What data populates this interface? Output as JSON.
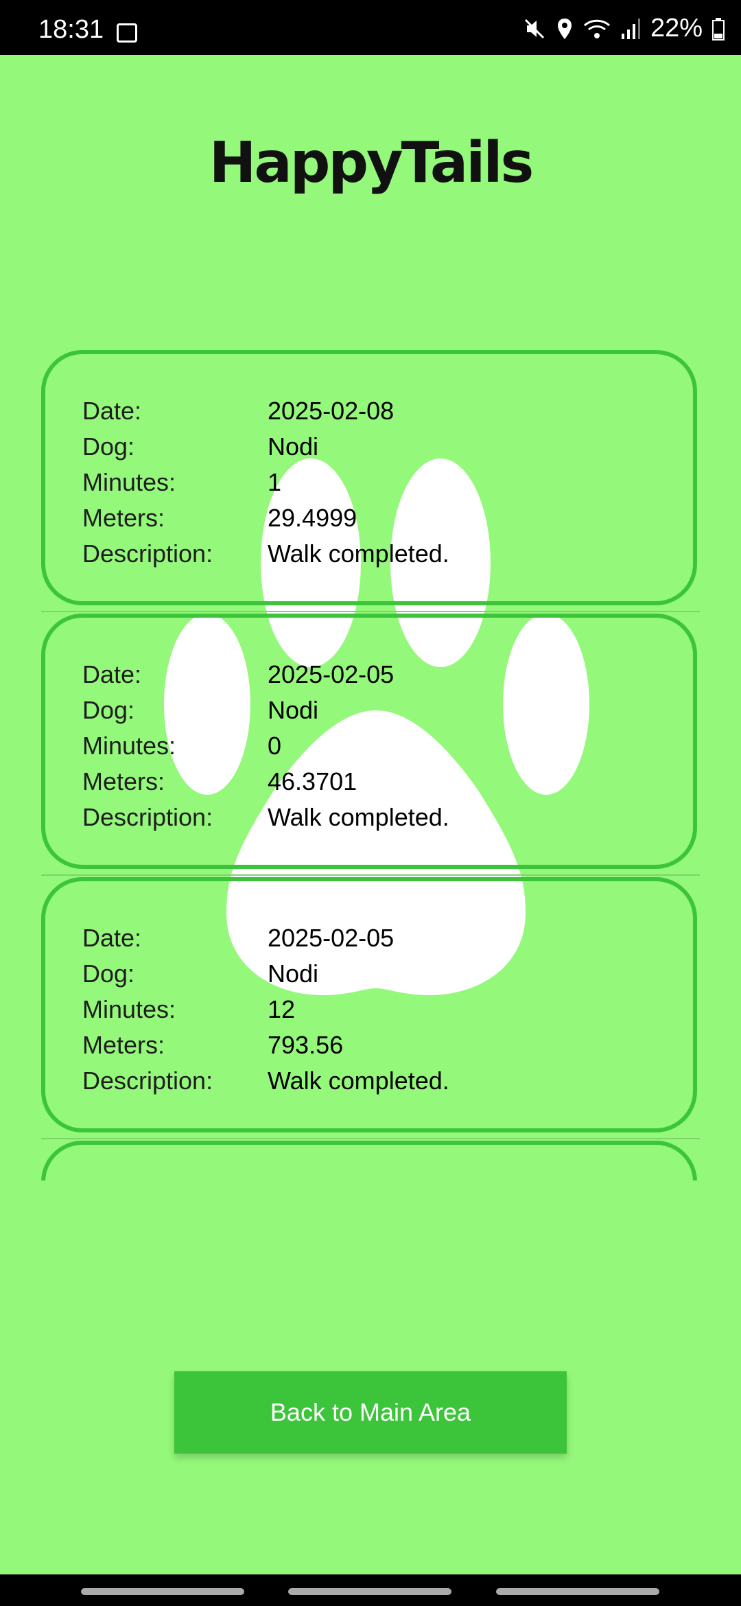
{
  "status": {
    "time": "18:31",
    "battery": "22%"
  },
  "app": {
    "title": "HappyTails"
  },
  "walks": [
    {
      "date_label": "Date:",
      "date": "2025-02-08",
      "dog_label": "Dog:",
      "dog": "Nodi",
      "minutes_label": "Minutes:",
      "minutes": "1",
      "meters_label": "Meters:",
      "meters": "29.4999",
      "description_label": "Description:",
      "description": "Walk completed."
    },
    {
      "date_label": "Date:",
      "date": "2025-02-05",
      "dog_label": "Dog:",
      "dog": "Nodi",
      "minutes_label": "Minutes:",
      "minutes": "0",
      "meters_label": "Meters:",
      "meters": "46.3701",
      "description_label": "Description:",
      "description": "Walk completed."
    },
    {
      "date_label": "Date:",
      "date": "2025-02-05",
      "dog_label": "Dog:",
      "dog": "Nodi",
      "minutes_label": "Minutes:",
      "minutes": "12",
      "meters_label": "Meters:",
      "meters": "793.56",
      "description_label": "Description:",
      "description": "Walk completed."
    }
  ],
  "actions": {
    "back_label": "Back to Main Area"
  },
  "colors": {
    "background": "#94f87a",
    "accent": "#3cc53a"
  }
}
